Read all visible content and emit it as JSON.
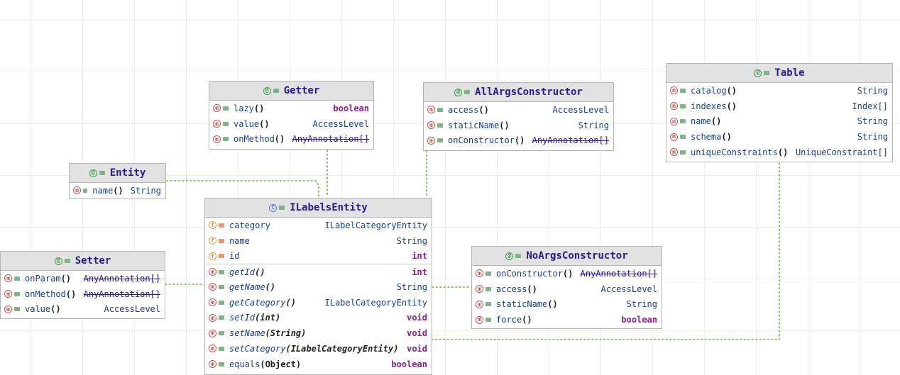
{
  "connections_color": "#6aa329",
  "nodes": {
    "getter": {
      "title": "Getter",
      "icon": "annotation-icon",
      "rows": [
        {
          "kind": "method",
          "name": "lazy",
          "params": "()",
          "type": "boolean"
        },
        {
          "kind": "method",
          "name": "value",
          "params": "()",
          "type": "AccessLevel"
        },
        {
          "kind": "method",
          "name": "onMethod",
          "params": "()",
          "type": "AnyAnnotation[]"
        }
      ]
    },
    "allargs": {
      "title": "AllArgsConstructor",
      "icon": "annotation-icon",
      "rows": [
        {
          "kind": "method",
          "name": "access",
          "params": "()",
          "type": "AccessLevel"
        },
        {
          "kind": "method",
          "name": "staticName",
          "params": "()",
          "type": "String"
        },
        {
          "kind": "method",
          "name": "onConstructor",
          "params": "()",
          "type": "AnyAnnotation[]"
        }
      ]
    },
    "table": {
      "title": "Table",
      "icon": "annotation-icon",
      "rows": [
        {
          "kind": "method",
          "name": "catalog",
          "params": "()",
          "type": "String"
        },
        {
          "kind": "method",
          "name": "indexes",
          "params": "()",
          "type": "Index[]"
        },
        {
          "kind": "method",
          "name": "name",
          "params": "()",
          "type": "String"
        },
        {
          "kind": "method",
          "name": "schema",
          "params": "()",
          "type": "String"
        },
        {
          "kind": "method",
          "name": "uniqueConstraints",
          "params": "()",
          "type": "UniqueConstraint[]"
        }
      ]
    },
    "entity": {
      "title": "Entity",
      "icon": "annotation-icon",
      "rows": [
        {
          "kind": "method",
          "name": "name",
          "params": "()",
          "type": "String"
        }
      ]
    },
    "ilabels": {
      "title": "ILabelsEntity",
      "icon": "class-icon",
      "rows": [
        {
          "kind": "field",
          "name": "category",
          "params": "",
          "type": "ILabelCategoryEntity"
        },
        {
          "kind": "field",
          "name": "name",
          "params": "",
          "type": "String"
        },
        {
          "kind": "field",
          "name": "id",
          "params": "",
          "type": "int"
        },
        {
          "kind": "method",
          "name": "getId",
          "params": "()",
          "type": "int"
        },
        {
          "kind": "method",
          "name": "getName",
          "params": "()",
          "type": "String"
        },
        {
          "kind": "method",
          "name": "getCategory",
          "params": "()",
          "type": "ILabelCategoryEntity"
        },
        {
          "kind": "method",
          "name": "setId",
          "params": "(int)",
          "type": "void"
        },
        {
          "kind": "method",
          "name": "setName",
          "params": "(String)",
          "type": "void"
        },
        {
          "kind": "method",
          "name": "setCategory",
          "params": "(ILabelCategoryEntity)",
          "type": "void"
        },
        {
          "kind": "method",
          "name": "equals",
          "params": "(Object)",
          "type": "boolean"
        }
      ]
    },
    "setter": {
      "title": "Setter",
      "icon": "annotation-icon",
      "rows": [
        {
          "kind": "method",
          "name": "onParam",
          "params": "()",
          "type": "AnyAnnotation[]"
        },
        {
          "kind": "method",
          "name": "onMethod",
          "params": "()",
          "type": "AnyAnnotation[]"
        },
        {
          "kind": "method",
          "name": "value",
          "params": "()",
          "type": "AccessLevel"
        }
      ]
    },
    "noargs": {
      "title": "NoArgsConstructor",
      "icon": "annotation-icon",
      "rows": [
        {
          "kind": "method",
          "name": "onConstructor",
          "params": "()",
          "type": "AnyAnnotation[]"
        },
        {
          "kind": "method",
          "name": "access",
          "params": "()",
          "type": "AccessLevel"
        },
        {
          "kind": "method",
          "name": "staticName",
          "params": "()",
          "type": "String"
        },
        {
          "kind": "method",
          "name": "force",
          "params": "()",
          "type": "boolean"
        }
      ]
    }
  }
}
